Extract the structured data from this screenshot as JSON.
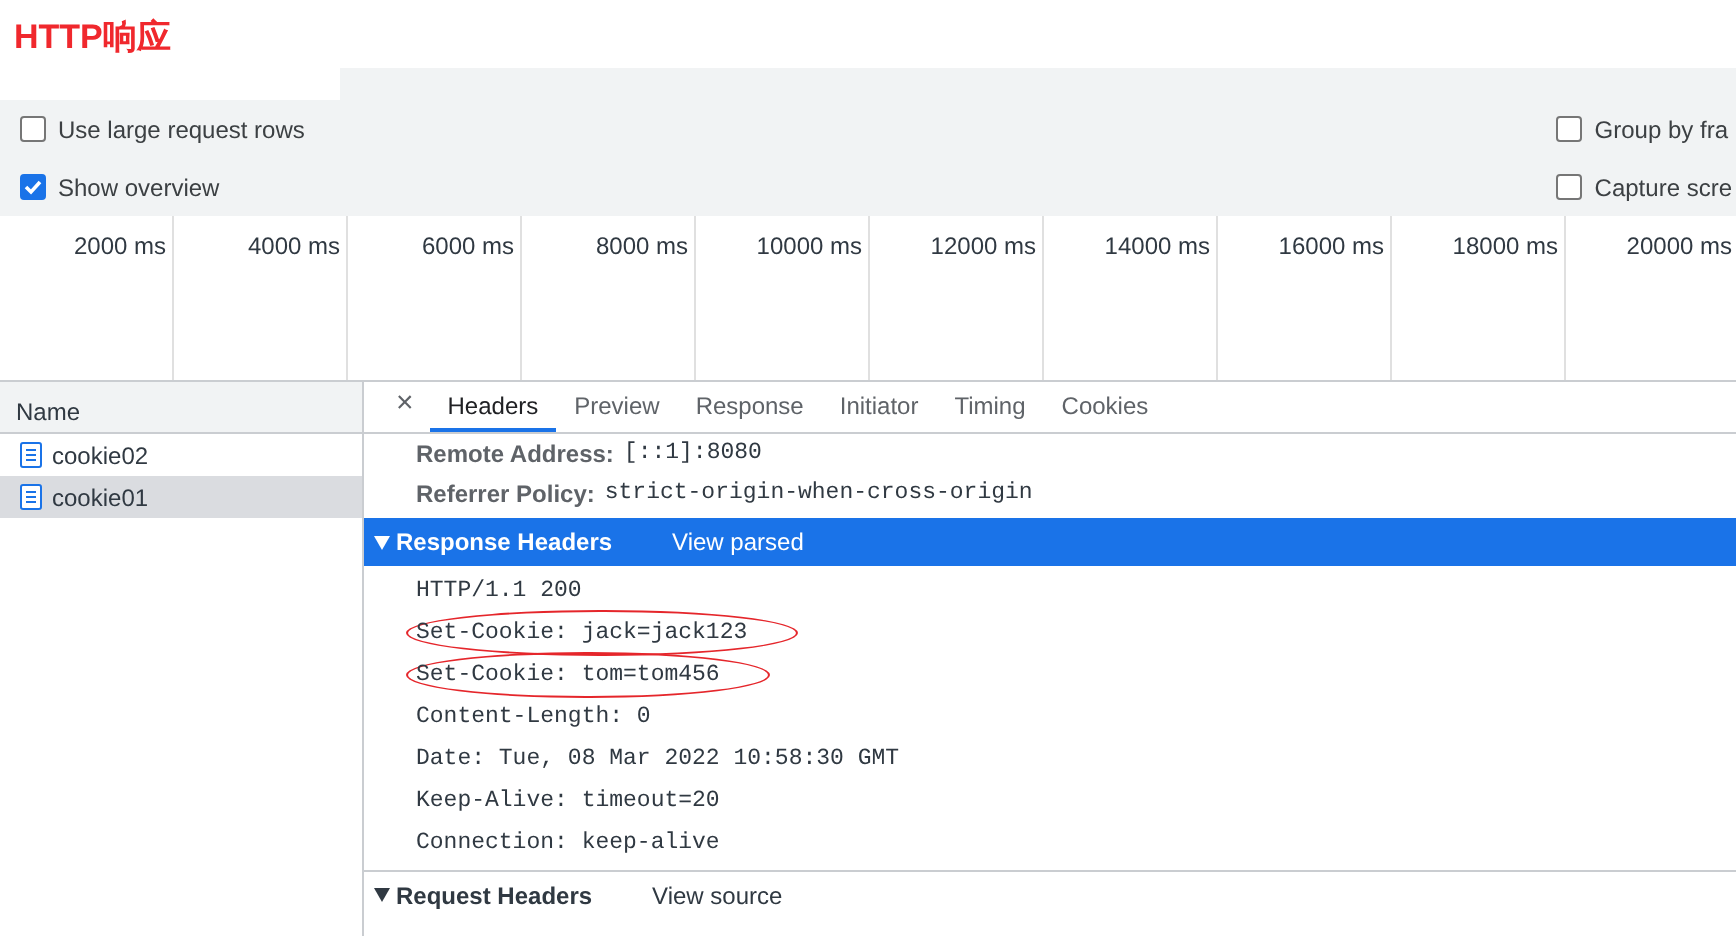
{
  "title": "HTTP响应",
  "settings": [
    {
      "label": "Use large request rows",
      "checked": false
    },
    {
      "label": "Show overview",
      "checked": true
    }
  ],
  "settings_right": [
    {
      "label": "Group by fra",
      "checked": false
    },
    {
      "label": "Capture scre",
      "checked": false
    }
  ],
  "timeline": {
    "ticks": [
      "2000 ms",
      "4000 ms",
      "6000 ms",
      "8000 ms",
      "10000 ms",
      "12000 ms",
      "14000 ms",
      "16000 ms",
      "18000 ms",
      "20000 ms"
    ]
  },
  "requests": {
    "column": "Name",
    "rows": [
      {
        "name": "cookie02",
        "selected": false
      },
      {
        "name": "cookie01",
        "selected": true
      }
    ]
  },
  "detail": {
    "close": "×",
    "tabs": [
      {
        "label": "Headers",
        "selected": true
      },
      {
        "label": "Preview",
        "selected": false
      },
      {
        "label": "Response",
        "selected": false
      },
      {
        "label": "Initiator",
        "selected": false
      },
      {
        "label": "Timing",
        "selected": false
      },
      {
        "label": "Cookies",
        "selected": false
      }
    ],
    "general": [
      {
        "key": "Remote Address:",
        "value": "[::1]:8080"
      },
      {
        "key": "Referrer Policy:",
        "value": "strict-origin-when-cross-origin"
      }
    ],
    "response_headers": {
      "title": "Response Headers",
      "link": "View parsed",
      "expanded": true,
      "lines": [
        {
          "text": "HTTP/1.1 200",
          "circled": false
        },
        {
          "text": "Set-Cookie: jack=jack123",
          "circled": true
        },
        {
          "text": "Set-Cookie: tom=tom456",
          "circled": true
        },
        {
          "text": "Content-Length: 0",
          "circled": false
        },
        {
          "text": "Date: Tue, 08 Mar 2022 10:58:30 GMT",
          "circled": false
        },
        {
          "text": "Keep-Alive: timeout=20",
          "circled": false
        },
        {
          "text": "Connection: keep-alive",
          "circled": false
        }
      ]
    },
    "request_headers": {
      "title": "Request Headers",
      "link": "View source",
      "expanded": true
    }
  }
}
